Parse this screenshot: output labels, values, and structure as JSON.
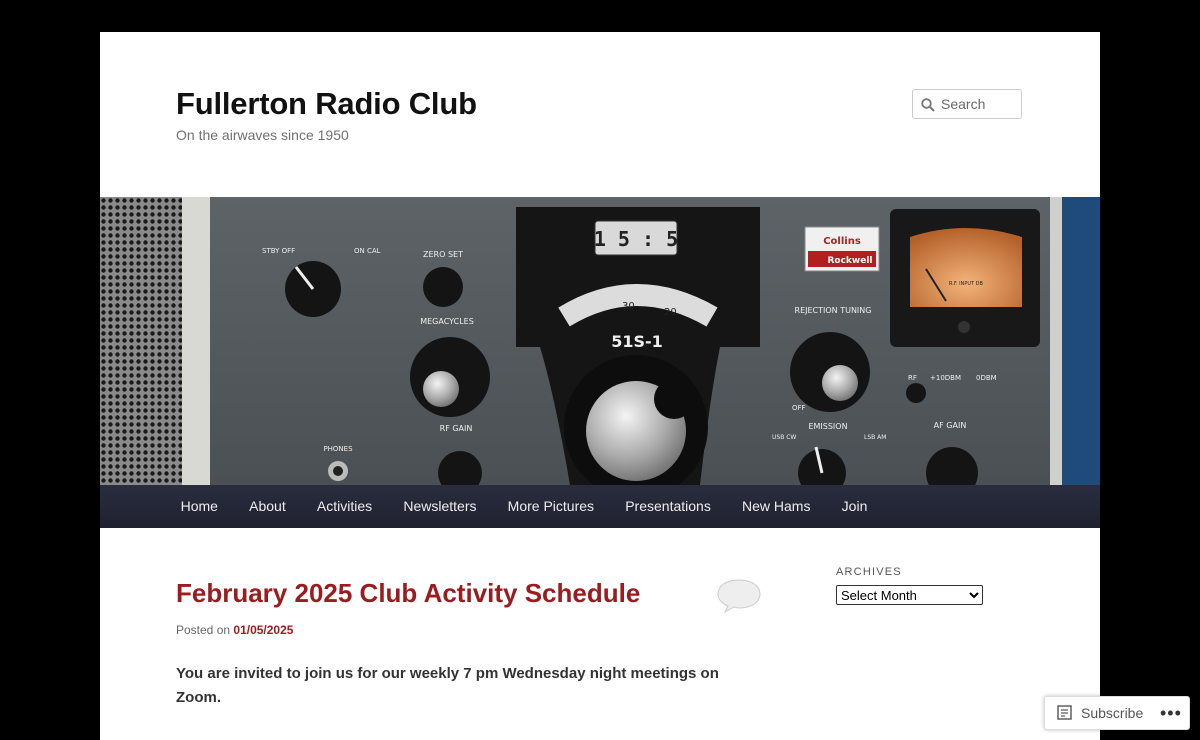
{
  "site": {
    "title": "Fullerton Radio Club",
    "description": "On the airwaves since 1950"
  },
  "search": {
    "placeholder": "Search",
    "icon": "search-icon"
  },
  "header_image": {
    "panel_labels": {
      "stby_off": "STBY OFF",
      "on_cal": "ON CAL",
      "zero_set": "ZERO SET",
      "megacycles": "MEGACYCLES",
      "phones": "PHONES",
      "rf_gain": "RF GAIN",
      "model": "51S-1",
      "dial_left": "30",
      "dial_right": "20",
      "brand_top": "Collins",
      "brand_bottom": "Rockwell",
      "rejection_tuning": "REJECTION TUNING",
      "off": "OFF",
      "rf_input": "R.F. INPUT DB",
      "rf_line": "RF",
      "plus10dbm": "+10DBM",
      "odbm": "0DBM",
      "emission": "EMISSION",
      "usb_cw": "USB CW",
      "lsb_am": "LSB AM",
      "af_gain": "AF GAIN"
    }
  },
  "nav": {
    "items": [
      "Home",
      "About",
      "Activities",
      "Newsletters",
      "More Pictures",
      "Presentations",
      "New Hams",
      "Join"
    ]
  },
  "post": {
    "title": "February 2025 Club Activity Schedule",
    "posted_on": "Posted on",
    "date": "01/05/2025",
    "body": "You are invited to join us for our weekly 7 pm Wednesday night meetings on Zoom."
  },
  "sidebar": {
    "archives_title": "ARCHIVES",
    "archives_selected": "Select Month"
  },
  "subscribe": {
    "label": "Subscribe",
    "more": "•••"
  },
  "colors": {
    "accent": "#9b1b1e",
    "nav_bg": "#252838",
    "background": "#000000"
  }
}
